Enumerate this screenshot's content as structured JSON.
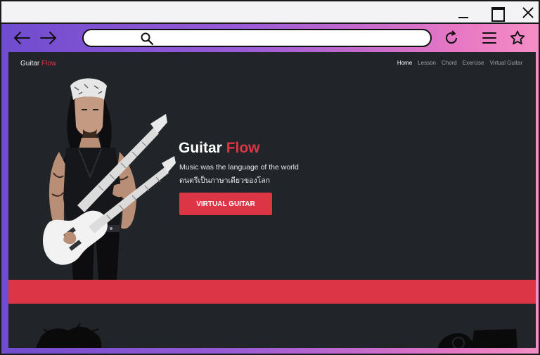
{
  "browser": {
    "window_controls": [
      "minimize",
      "maximize",
      "close"
    ],
    "toolbar_icons": [
      "back-arrow-icon",
      "forward-arrow-icon",
      "search-icon",
      "reload-icon",
      "menu-icon",
      "star-icon"
    ],
    "address_placeholder": ""
  },
  "site": {
    "brand_main": "Guitar",
    "brand_accent": "Flow",
    "nav": [
      "Home",
      "Lesson",
      "Chord",
      "Exercise",
      "Virtual Guitar"
    ],
    "active_nav": "Home"
  },
  "hero": {
    "title_main": "Guitar",
    "title_accent": "Flow",
    "subtitle_en": "Music was the language of the world",
    "subtitle_th": "ดนตรีเป็นภาษาเดียวของโลก",
    "cta_label": "VIRTUAL GUITAR"
  },
  "colors": {
    "accent": "#dc3545",
    "page_bg": "#212429",
    "gradient_start": "#6f4ccf",
    "gradient_end": "#f58ec6"
  }
}
